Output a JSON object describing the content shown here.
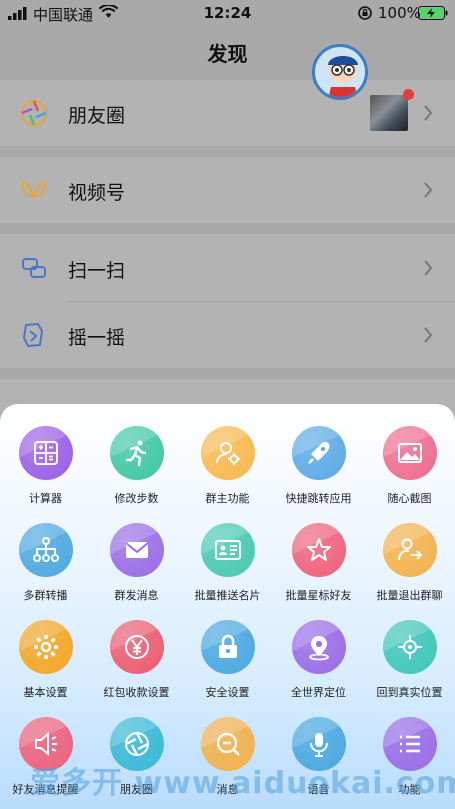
{
  "status_bar": {
    "carrier": "中国联通",
    "time": "12:24",
    "battery_percent": "100%"
  },
  "nav": {
    "title": "发现"
  },
  "list": {
    "moments": "朋友圈",
    "channels": "视频号",
    "scan": "扫一扫",
    "shake": "摇一摇"
  },
  "tools": [
    {
      "label": "计算器",
      "icon": "calculator-icon",
      "color": "#9b5de5"
    },
    {
      "label": "修改步数",
      "icon": "running-icon",
      "color": "#3ec7a3"
    },
    {
      "label": "群主功能",
      "icon": "user-gear-icon",
      "color": "#f7b84b"
    },
    {
      "label": "快捷跳转应用",
      "icon": "rocket-icon",
      "color": "#5aa9e6"
    },
    {
      "label": "随心截图",
      "icon": "image-icon",
      "color": "#ef6a8e"
    },
    {
      "label": "多群转播",
      "icon": "network-icon",
      "color": "#4aa8e0"
    },
    {
      "label": "群发消息",
      "icon": "mail-icon",
      "color": "#9b6be6"
    },
    {
      "label": "批量推送名片",
      "icon": "card-icon",
      "color": "#48c9b0"
    },
    {
      "label": "批量星标好友",
      "icon": "star-icon",
      "color": "#f0607a"
    },
    {
      "label": "批量退出群聊",
      "icon": "exit-icon",
      "color": "#f5b14a"
    },
    {
      "label": "基本设置",
      "icon": "gear-icon",
      "color": "#f5a623"
    },
    {
      "label": "红包收款设置",
      "icon": "yuan-icon",
      "color": "#ee5b6e"
    },
    {
      "label": "安全设置",
      "icon": "lock-icon",
      "color": "#4aa8e0"
    },
    {
      "label": "全世界定位",
      "icon": "location-icon",
      "color": "#9b6be6"
    },
    {
      "label": "回到真实位置",
      "icon": "crosshair-icon",
      "color": "#3ec7b7"
    },
    {
      "label": "好友消息提醒",
      "icon": "speaker-icon",
      "color": "#f0607a"
    },
    {
      "label": "朋友圈",
      "icon": "aperture-icon",
      "color": "#39b9d6"
    },
    {
      "label": "消息",
      "icon": "zoom-out-icon",
      "color": "#f5b14a"
    },
    {
      "label": "语音",
      "icon": "mic-icon",
      "color": "#4aa8e0"
    },
    {
      "label": "功能",
      "icon": "list-icon",
      "color": "#9b6be6"
    }
  ],
  "watermark": "爱多开 www.aiduokai.com"
}
